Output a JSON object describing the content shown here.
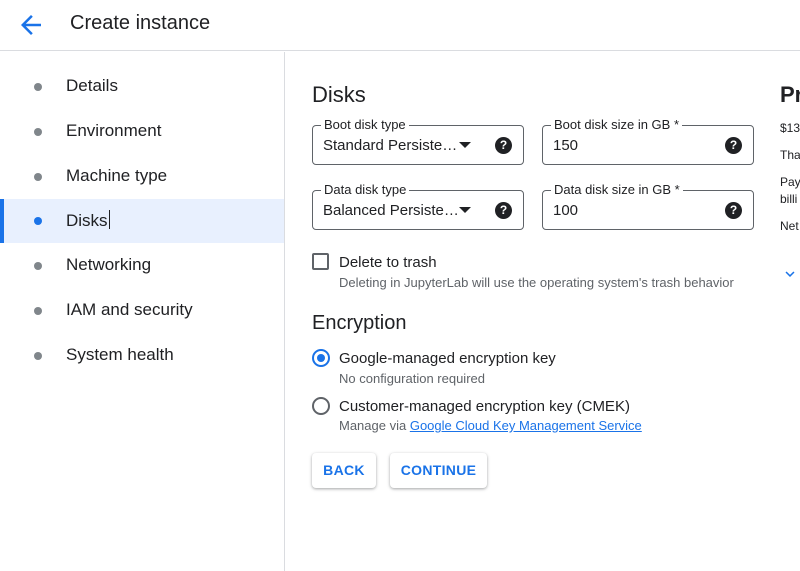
{
  "header": {
    "title": "Create instance",
    "back_icon": "arrow-back-icon"
  },
  "sidebar": {
    "items": [
      {
        "label": "Details",
        "active": false
      },
      {
        "label": "Environment",
        "active": false
      },
      {
        "label": "Machine type",
        "active": false
      },
      {
        "label": "Disks",
        "active": true
      },
      {
        "label": "Networking",
        "active": false
      },
      {
        "label": "IAM and security",
        "active": false
      },
      {
        "label": "System health",
        "active": false
      }
    ]
  },
  "disks": {
    "title": "Disks",
    "boot_disk_type": {
      "label": "Boot disk type",
      "value": "Standard Persiste…"
    },
    "boot_disk_size": {
      "label": "Boot disk size in GB *",
      "value": "150"
    },
    "data_disk_type": {
      "label": "Data disk type",
      "value": "Balanced Persiste…"
    },
    "data_disk_size": {
      "label": "Data disk size in GB *",
      "value": "100"
    },
    "delete_to_trash": {
      "label": "Delete to trash",
      "description": "Deleting in JupyterLab will use the operating system's trash behavior",
      "checked": false
    }
  },
  "encryption": {
    "title": "Encryption",
    "options": [
      {
        "label": "Google-managed encryption key",
        "description": "No configuration required",
        "selected": true
      },
      {
        "label": "Customer-managed encryption key (CMEK)",
        "description_prefix": "Manage via ",
        "link_text": "Google Cloud Key Management Service",
        "selected": false
      }
    ]
  },
  "buttons": {
    "back": "BACK",
    "continue": "CONTINUE"
  },
  "right_panel": {
    "title": "Pr",
    "line1": "$13",
    "line2": "Tha",
    "line3": "Pay",
    "line4": "billi",
    "line5": "Net",
    "expand_icon": "chevron-down-icon"
  },
  "colors": {
    "accent": "#1a73e8",
    "active_nav_bg": "#e8f0fe",
    "border": "#dadce0",
    "text": "#202124",
    "secondary_text": "#5f6368"
  }
}
